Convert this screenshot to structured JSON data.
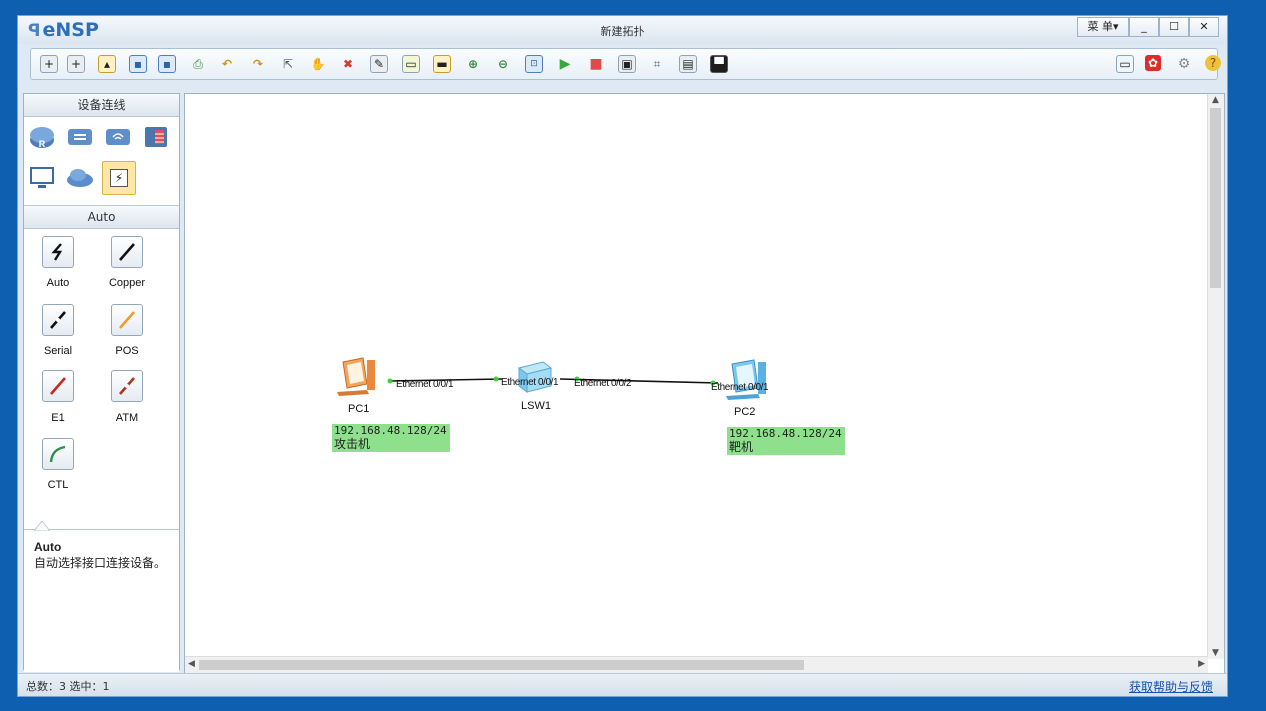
{
  "app": {
    "name": "eNSP",
    "window_title": "新建拓扑"
  },
  "window_controls": {
    "menu": "菜 单▾",
    "minimize": "_",
    "maximize": "☐",
    "close": "✕"
  },
  "toolbar": {
    "icons": [
      "new-topology-icon",
      "new-test-icon",
      "open-icon",
      "save-icon",
      "save-as-icon",
      "print-icon",
      "undo-icon",
      "redo-icon",
      "select-icon",
      "pan-hand-icon",
      "delete-icon",
      "delete-link-icon",
      "add-text-icon",
      "add-shape-icon",
      "zoom-in-icon",
      "zoom-out-icon",
      "fit-view-icon",
      "start-device-icon",
      "stop-device-icon",
      "capture-icon",
      "show-interface-icon",
      "palette-icon",
      "terminal-icon"
    ],
    "right_icons": [
      "chat-icon",
      "huawei-icon",
      "settings-icon",
      "help-icon"
    ]
  },
  "left_panel": {
    "section_title": "设备连线",
    "cable_section_title": "Auto",
    "cables": [
      {
        "label": "Auto"
      },
      {
        "label": "Copper"
      },
      {
        "label": "Serial"
      },
      {
        "label": "POS"
      },
      {
        "label": "E1"
      },
      {
        "label": "ATM"
      },
      {
        "label": "CTL"
      }
    ],
    "description": {
      "title": "Auto",
      "text": "自动选择接口连接设备。"
    }
  },
  "topology": {
    "devices": [
      {
        "name": "PC1"
      },
      {
        "name": "LSW1"
      },
      {
        "name": "PC2"
      }
    ],
    "ports": [
      {
        "label": "Ethernet 0/0/1"
      },
      {
        "label": "Ethernet 0/0/1"
      },
      {
        "label": "Ethernet 0/0/2"
      },
      {
        "label": "Ethernet 0/0/1"
      }
    ],
    "notes": [
      {
        "ip": "192.168.48.128/24",
        "desc": "攻击机"
      },
      {
        "ip": "192.168.48.128/24",
        "desc": "靶机"
      }
    ]
  },
  "status": {
    "summary": "总数：3  选中：1",
    "help_link": "获取帮助与反馈"
  },
  "colors": {
    "background": "#0f5fb0",
    "note_green": "#8ee08c",
    "link_blue": "#1a4fa8"
  }
}
